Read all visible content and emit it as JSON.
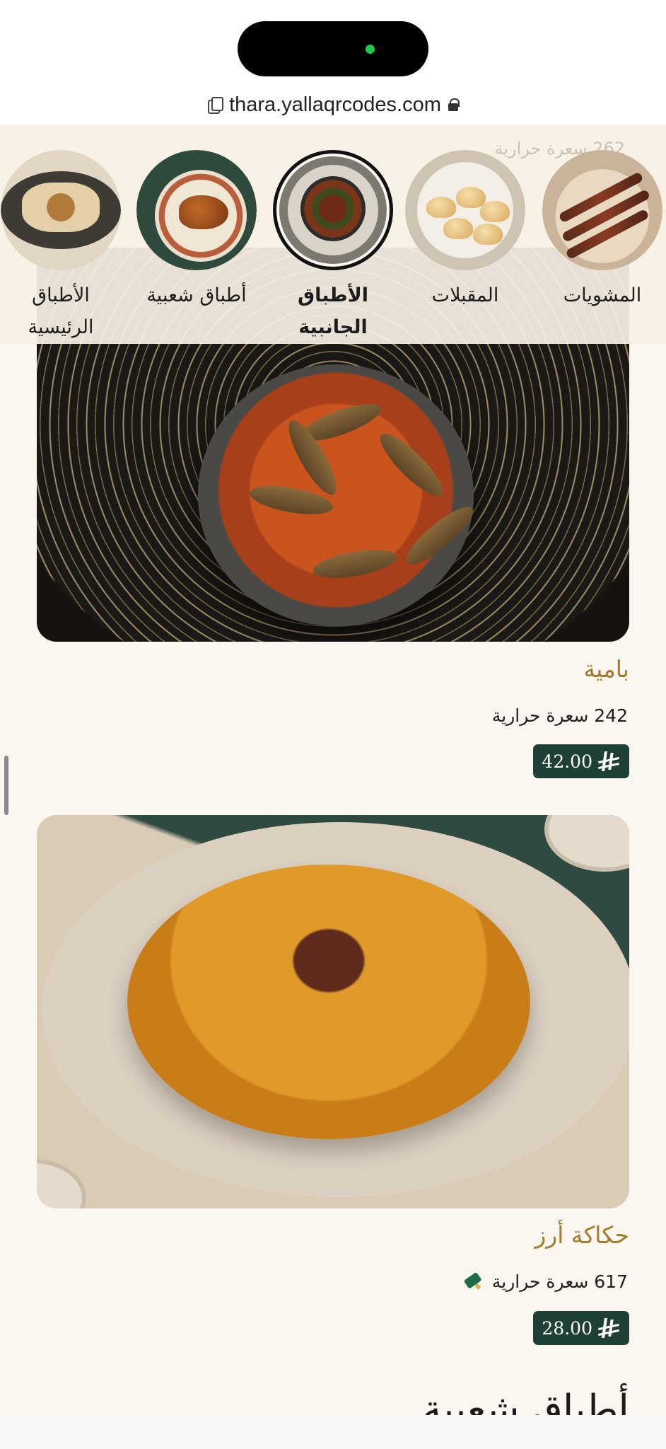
{
  "browser": {
    "url": "thara.yallaqrcodes.com"
  },
  "categories": [
    {
      "id": "grills",
      "label": "المشويات",
      "active": false
    },
    {
      "id": "starters",
      "label": "المقبلات",
      "active": false
    },
    {
      "id": "sides",
      "label": "الأطباق الجانبية",
      "active": true
    },
    {
      "id": "popular",
      "label": "أطباق شعبية",
      "active": false
    },
    {
      "id": "mains",
      "label": "الأطباق الرئيسية",
      "active": false
    }
  ],
  "nav_ghost_text": "262 سعرة حرارية",
  "dishes": [
    {
      "name": "بامية",
      "calories": "242 سعرة حرارية",
      "price": "42.00",
      "vegetarian": false
    },
    {
      "name": "حكاكة أرز",
      "calories": "617 سعرة حرارية",
      "price": "28.00",
      "vegetarian": true
    }
  ],
  "next_section_heading": "أطباق شعبية",
  "colors": {
    "accent_gold": "#a37a2e",
    "price_badge": "#1f4034",
    "background": "#fbf6ef",
    "veg_icon": "#1f6b4a"
  }
}
